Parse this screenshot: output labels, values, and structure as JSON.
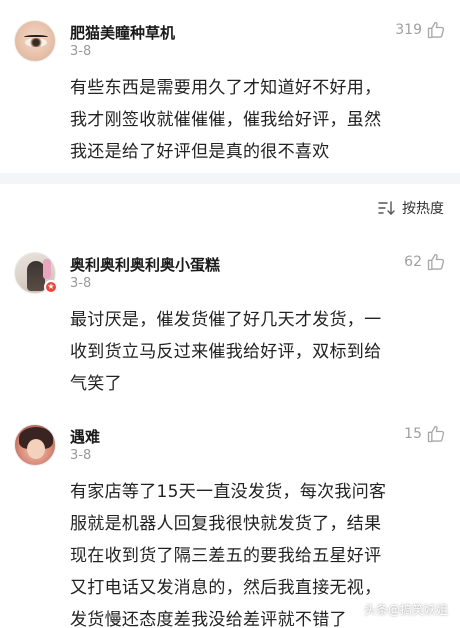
{
  "comments": [
    {
      "username": "肥猫美瞳种草机",
      "date": "3-8",
      "likes": "319",
      "lines": [
        "有些东西是需要用久了才知道好不好用，",
        "我才刚签收就催催催，催我给好评，虽然",
        "我还是给了好评但是真的很不喜欢"
      ]
    },
    {
      "username": "奥利奥利奥利奥小蛋糕",
      "date": "3-8",
      "likes": "62",
      "lines": [
        "最讨厌是，催发货催了好几天才发货，一",
        "收到货立马反过来催我给好评，双标到给",
        "气笑了"
      ]
    },
    {
      "username": "遇难",
      "date": "3-8",
      "likes": "15",
      "lines": [
        "有家店等了15天一直没发货，每次我问客",
        "服就是机器人回复我很快就发货了，结果",
        "现在收到货了隔三差五的要我给五星好评",
        "又打电话又发消息的，然后我直接无视，",
        "发货慢还态度差我没给差评就不错了"
      ]
    }
  ],
  "sort": {
    "label": "按热度",
    "icon": "sort-icon"
  },
  "watermark": {
    "text": "头条@搞笑妖姐"
  },
  "colors": {
    "text": "#222222",
    "muted": "#999999",
    "badge": "#e8473a",
    "divider": "#f4f5f7"
  }
}
